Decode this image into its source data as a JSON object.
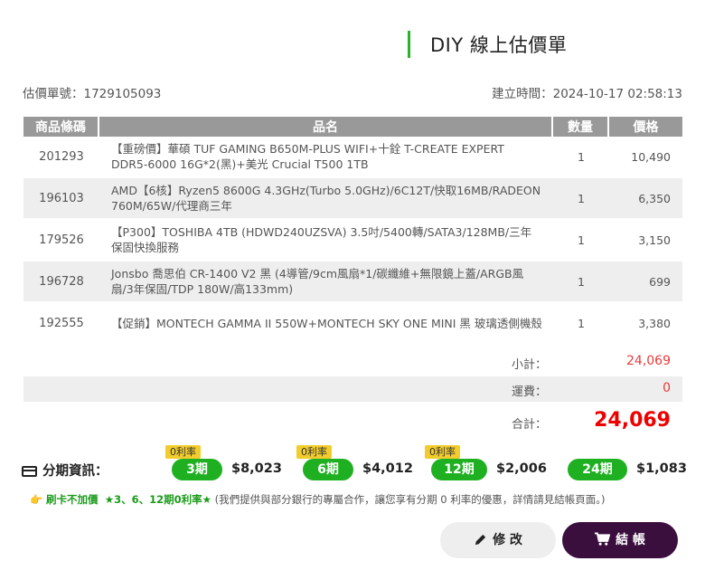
{
  "header": {
    "title": "DIY 線上估價單"
  },
  "meta": {
    "quote_no": "估價單號：1729105093",
    "created": "建立時間：2024-10-17 02:58:13"
  },
  "table": {
    "headers": {
      "sku": "商品條碼",
      "name": "品名",
      "qty": "數量",
      "price": "價格"
    },
    "rows": [
      {
        "sku": "201293",
        "name": "【重磅價】華碩 TUF GAMING B650M-PLUS WIFI+十銓 T-CREATE EXPERT DDR5-6000 16G*2(黑)+美光 Crucial T500 1TB",
        "qty": "1",
        "price": "10,490"
      },
      {
        "sku": "196103",
        "name": "AMD【6核】Ryzen5 8600G 4.3GHz(Turbo 5.0GHz)/6C12T/快取16MB/RADEON 760M/65W/代理商三年",
        "qty": "1",
        "price": "6,350"
      },
      {
        "sku": "179526",
        "name": "【P300】TOSHIBA 4TB (HDWD240UZSVA) 3.5吋/5400轉/SATA3/128MB/三年保固快換服務",
        "qty": "1",
        "price": "3,150"
      },
      {
        "sku": "196728",
        "name": "Jonsbo 喬思伯 CR-1400 V2 黑 (4導管/9cm風扇*1/碳纖維+無限鏡上蓋/ARGB風扇/3年保固/TDP 180W/高133mm)",
        "qty": "1",
        "price": "699"
      },
      {
        "sku": "192555",
        "name": "【促銷】MONTECH GAMMA II 550W+MONTECH SKY ONE MINI 黑 玻璃透側機殼",
        "qty": "1",
        "price": "3,380"
      }
    ]
  },
  "summary": {
    "subtotal_label": "小計：",
    "subtotal": "24,069",
    "shipping_label": "運費：",
    "shipping": "0",
    "total_label": "合計：",
    "total": "24,069"
  },
  "installment": {
    "label": "分期資訊：",
    "plans": [
      {
        "tag": "0利率",
        "term": "3期",
        "amount": "$8,023"
      },
      {
        "tag": "0利率",
        "term": "6期",
        "amount": "$4,012"
      },
      {
        "tag": "0利率",
        "term": "12期",
        "amount": "$2,006"
      },
      {
        "tag": "",
        "term": "24期",
        "amount": "$1,083"
      }
    ],
    "note_lead": "刷卡不加價",
    "note_green": "★3、6、12期0利率★",
    "note_rest": "(我們提供與部分銀行的專屬合作，讓您享有分期 0 利率的優惠，詳情請見結帳頁面。)"
  },
  "buttons": {
    "edit": "修 改",
    "checkout": "結 帳"
  },
  "colors": {
    "accent_green": "#1fb022",
    "checkout_bg": "#3a0f3e",
    "price_red": "#e00000"
  }
}
